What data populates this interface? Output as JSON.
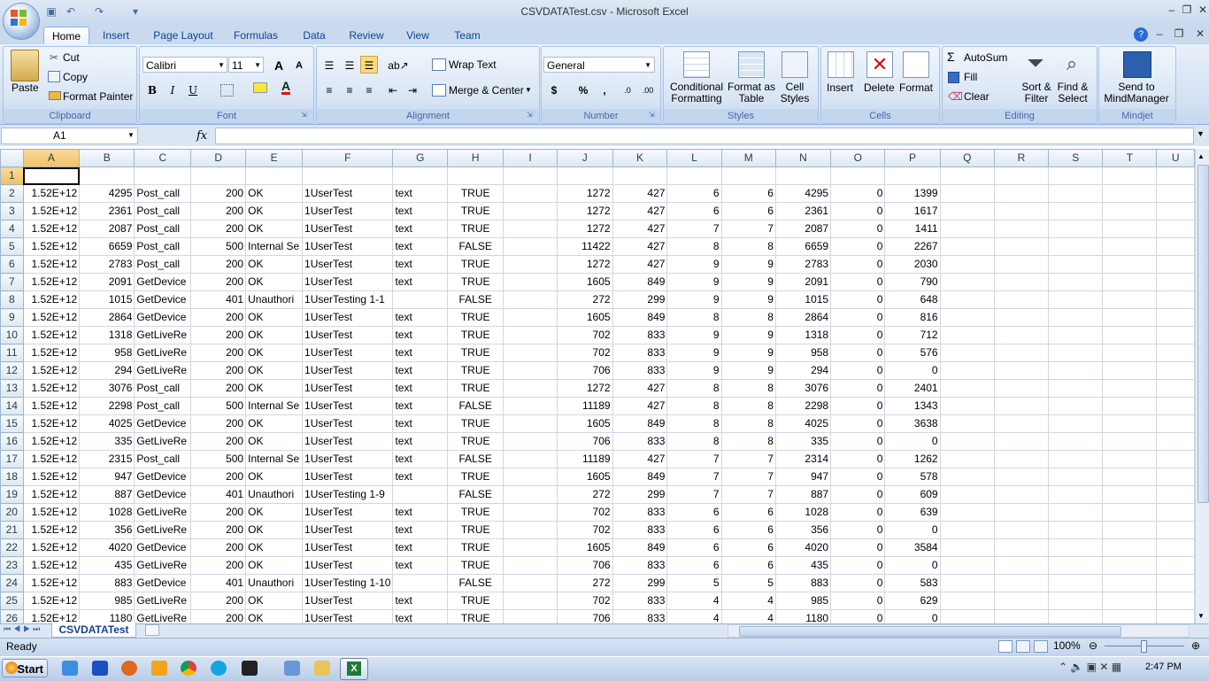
{
  "window": {
    "title": "CSVDATATest.csv - Microsoft Excel",
    "minimize": "–",
    "restore": "❐",
    "close": "✕"
  },
  "tabs": [
    "Home",
    "Insert",
    "Page Layout",
    "Formulas",
    "Data",
    "Review",
    "View",
    "Team"
  ],
  "ribbon": {
    "clipboard": {
      "label": "Clipboard",
      "paste": "Paste",
      "cut": "Cut",
      "copy": "Copy",
      "format_painter": "Format Painter"
    },
    "font": {
      "label": "Font",
      "name": "Calibri",
      "size": "11",
      "bold": "B",
      "italic": "I",
      "underline": "U",
      "grow": "A",
      "shrink": "A"
    },
    "alignment": {
      "label": "Alignment",
      "wrap": "Wrap Text",
      "merge": "Merge & Center"
    },
    "number": {
      "label": "Number",
      "format": "General",
      "currency": "$",
      "percent": "%",
      "comma": ",",
      "inc": ".0",
      "dec": ".00"
    },
    "styles": {
      "label": "Styles",
      "conditional": "Conditional Formatting",
      "format_table": "Format as Table",
      "cell_styles": "Cell Styles"
    },
    "cells": {
      "label": "Cells",
      "insert": "Insert",
      "delete": "Delete",
      "format": "Format"
    },
    "editing": {
      "label": "Editing",
      "autosum": "AutoSum",
      "fill": "Fill",
      "clear": "Clear",
      "sort": "Sort & Filter",
      "find": "Find & Select"
    },
    "mindjet": {
      "label": "Mindjet",
      "send": "Send to MindManager"
    }
  },
  "formula_bar": {
    "name_box": "A1",
    "fx": "fx",
    "value": ""
  },
  "columns": [
    "A",
    "B",
    "C",
    "D",
    "E",
    "F",
    "G",
    "H",
    "I",
    "J",
    "K",
    "L",
    "M",
    "N",
    "O",
    "P",
    "Q",
    "R",
    "S",
    "T",
    "U"
  ],
  "rows": [
    [
      "",
      "",
      "",
      "",
      "",
      "",
      "",
      "",
      "",
      "",
      "",
      "",
      "",
      "",
      "",
      "",
      "",
      "",
      "",
      "",
      ""
    ],
    [
      "1.52E+12",
      "4295",
      "Post_call",
      "200",
      "OK",
      "1UserTest",
      "text",
      "TRUE",
      "",
      "1272",
      "427",
      "6",
      "6",
      "4295",
      "0",
      "1399",
      "",
      "",
      "",
      "",
      ""
    ],
    [
      "1.52E+12",
      "2361",
      "Post_call",
      "200",
      "OK",
      "1UserTest",
      "text",
      "TRUE",
      "",
      "1272",
      "427",
      "6",
      "6",
      "2361",
      "0",
      "1617",
      "",
      "",
      "",
      "",
      ""
    ],
    [
      "1.52E+12",
      "2087",
      "Post_call",
      "200",
      "OK",
      "1UserTest",
      "text",
      "TRUE",
      "",
      "1272",
      "427",
      "7",
      "7",
      "2087",
      "0",
      "1411",
      "",
      "",
      "",
      "",
      ""
    ],
    [
      "1.52E+12",
      "6659",
      "Post_call",
      "500",
      "Internal Se",
      "1UserTest",
      "text",
      "FALSE",
      "",
      "11422",
      "427",
      "8",
      "8",
      "6659",
      "0",
      "2267",
      "",
      "",
      "",
      "",
      ""
    ],
    [
      "1.52E+12",
      "2783",
      "Post_call",
      "200",
      "OK",
      "1UserTest",
      "text",
      "TRUE",
      "",
      "1272",
      "427",
      "9",
      "9",
      "2783",
      "0",
      "2030",
      "",
      "",
      "",
      "",
      ""
    ],
    [
      "1.52E+12",
      "2091",
      "GetDevice",
      "200",
      "OK",
      "1UserTest",
      "text",
      "TRUE",
      "",
      "1605",
      "849",
      "9",
      "9",
      "2091",
      "0",
      "790",
      "",
      "",
      "",
      "",
      ""
    ],
    [
      "1.52E+12",
      "1015",
      "GetDevice",
      "401",
      "Unauthori",
      "1UserTesting 1-1",
      "",
      "FALSE",
      "",
      "272",
      "299",
      "9",
      "9",
      "1015",
      "0",
      "648",
      "",
      "",
      "",
      "",
      ""
    ],
    [
      "1.52E+12",
      "2864",
      "GetDevice",
      "200",
      "OK",
      "1UserTest",
      "text",
      "TRUE",
      "",
      "1605",
      "849",
      "8",
      "8",
      "2864",
      "0",
      "816",
      "",
      "",
      "",
      "",
      ""
    ],
    [
      "1.52E+12",
      "1318",
      "GetLiveRe",
      "200",
      "OK",
      "1UserTest",
      "text",
      "TRUE",
      "",
      "702",
      "833",
      "9",
      "9",
      "1318",
      "0",
      "712",
      "",
      "",
      "",
      "",
      ""
    ],
    [
      "1.52E+12",
      "958",
      "GetLiveRe",
      "200",
      "OK",
      "1UserTest",
      "text",
      "TRUE",
      "",
      "702",
      "833",
      "9",
      "9",
      "958",
      "0",
      "576",
      "",
      "",
      "",
      "",
      ""
    ],
    [
      "1.52E+12",
      "294",
      "GetLiveRe",
      "200",
      "OK",
      "1UserTest",
      "text",
      "TRUE",
      "",
      "706",
      "833",
      "9",
      "9",
      "294",
      "0",
      "0",
      "",
      "",
      "",
      "",
      ""
    ],
    [
      "1.52E+12",
      "3076",
      "Post_call",
      "200",
      "OK",
      "1UserTest",
      "text",
      "TRUE",
      "",
      "1272",
      "427",
      "8",
      "8",
      "3076",
      "0",
      "2401",
      "",
      "",
      "",
      "",
      ""
    ],
    [
      "1.52E+12",
      "2298",
      "Post_call",
      "500",
      "Internal Se",
      "1UserTest",
      "text",
      "FALSE",
      "",
      "11189",
      "427",
      "8",
      "8",
      "2298",
      "0",
      "1343",
      "",
      "",
      "",
      "",
      ""
    ],
    [
      "1.52E+12",
      "4025",
      "GetDevice",
      "200",
      "OK",
      "1UserTest",
      "text",
      "TRUE",
      "",
      "1605",
      "849",
      "8",
      "8",
      "4025",
      "0",
      "3638",
      "",
      "",
      "",
      "",
      ""
    ],
    [
      "1.52E+12",
      "335",
      "GetLiveRe",
      "200",
      "OK",
      "1UserTest",
      "text",
      "TRUE",
      "",
      "706",
      "833",
      "8",
      "8",
      "335",
      "0",
      "0",
      "",
      "",
      "",
      "",
      ""
    ],
    [
      "1.52E+12",
      "2315",
      "Post_call",
      "500",
      "Internal Se",
      "1UserTest",
      "text",
      "FALSE",
      "",
      "11189",
      "427",
      "7",
      "7",
      "2314",
      "0",
      "1262",
      "",
      "",
      "",
      "",
      ""
    ],
    [
      "1.52E+12",
      "947",
      "GetDevice",
      "200",
      "OK",
      "1UserTest",
      "text",
      "TRUE",
      "",
      "1605",
      "849",
      "7",
      "7",
      "947",
      "0",
      "578",
      "",
      "",
      "",
      "",
      ""
    ],
    [
      "1.52E+12",
      "887",
      "GetDevice",
      "401",
      "Unauthori",
      "1UserTesting 1-9",
      "",
      "FALSE",
      "",
      "272",
      "299",
      "7",
      "7",
      "887",
      "0",
      "609",
      "",
      "",
      "",
      "",
      ""
    ],
    [
      "1.52E+12",
      "1028",
      "GetLiveRe",
      "200",
      "OK",
      "1UserTest",
      "text",
      "TRUE",
      "",
      "702",
      "833",
      "6",
      "6",
      "1028",
      "0",
      "639",
      "",
      "",
      "",
      "",
      ""
    ],
    [
      "1.52E+12",
      "356",
      "GetLiveRe",
      "200",
      "OK",
      "1UserTest",
      "text",
      "TRUE",
      "",
      "702",
      "833",
      "6",
      "6",
      "356",
      "0",
      "0",
      "",
      "",
      "",
      "",
      ""
    ],
    [
      "1.52E+12",
      "4020",
      "GetDevice",
      "200",
      "OK",
      "1UserTest",
      "text",
      "TRUE",
      "",
      "1605",
      "849",
      "6",
      "6",
      "4020",
      "0",
      "3584",
      "",
      "",
      "",
      "",
      ""
    ],
    [
      "1.52E+12",
      "435",
      "GetLiveRe",
      "200",
      "OK",
      "1UserTest",
      "text",
      "TRUE",
      "",
      "706",
      "833",
      "6",
      "6",
      "435",
      "0",
      "0",
      "",
      "",
      "",
      "",
      ""
    ],
    [
      "1.52E+12",
      "883",
      "GetDevice",
      "401",
      "Unauthori",
      "1UserTesting 1-10",
      "",
      "FALSE",
      "",
      "272",
      "299",
      "5",
      "5",
      "883",
      "0",
      "583",
      "",
      "",
      "",
      "",
      ""
    ],
    [
      "1.52E+12",
      "985",
      "GetLiveRe",
      "200",
      "OK",
      "1UserTest",
      "text",
      "TRUE",
      "",
      "702",
      "833",
      "4",
      "4",
      "985",
      "0",
      "629",
      "",
      "",
      "",
      "",
      ""
    ],
    [
      "1.52E+12",
      "1180",
      "GetLiveRe",
      "200",
      "OK",
      "1UserTest",
      "text",
      "TRUE",
      "",
      "706",
      "833",
      "4",
      "4",
      "1180",
      "0",
      "0",
      "",
      "",
      "",
      "",
      ""
    ]
  ],
  "sheet_tab": "CSVDATATest",
  "status": {
    "mode": "Ready",
    "zoom": "100%"
  },
  "taskbar": {
    "start": "Start",
    "time": "2:47 PM"
  }
}
